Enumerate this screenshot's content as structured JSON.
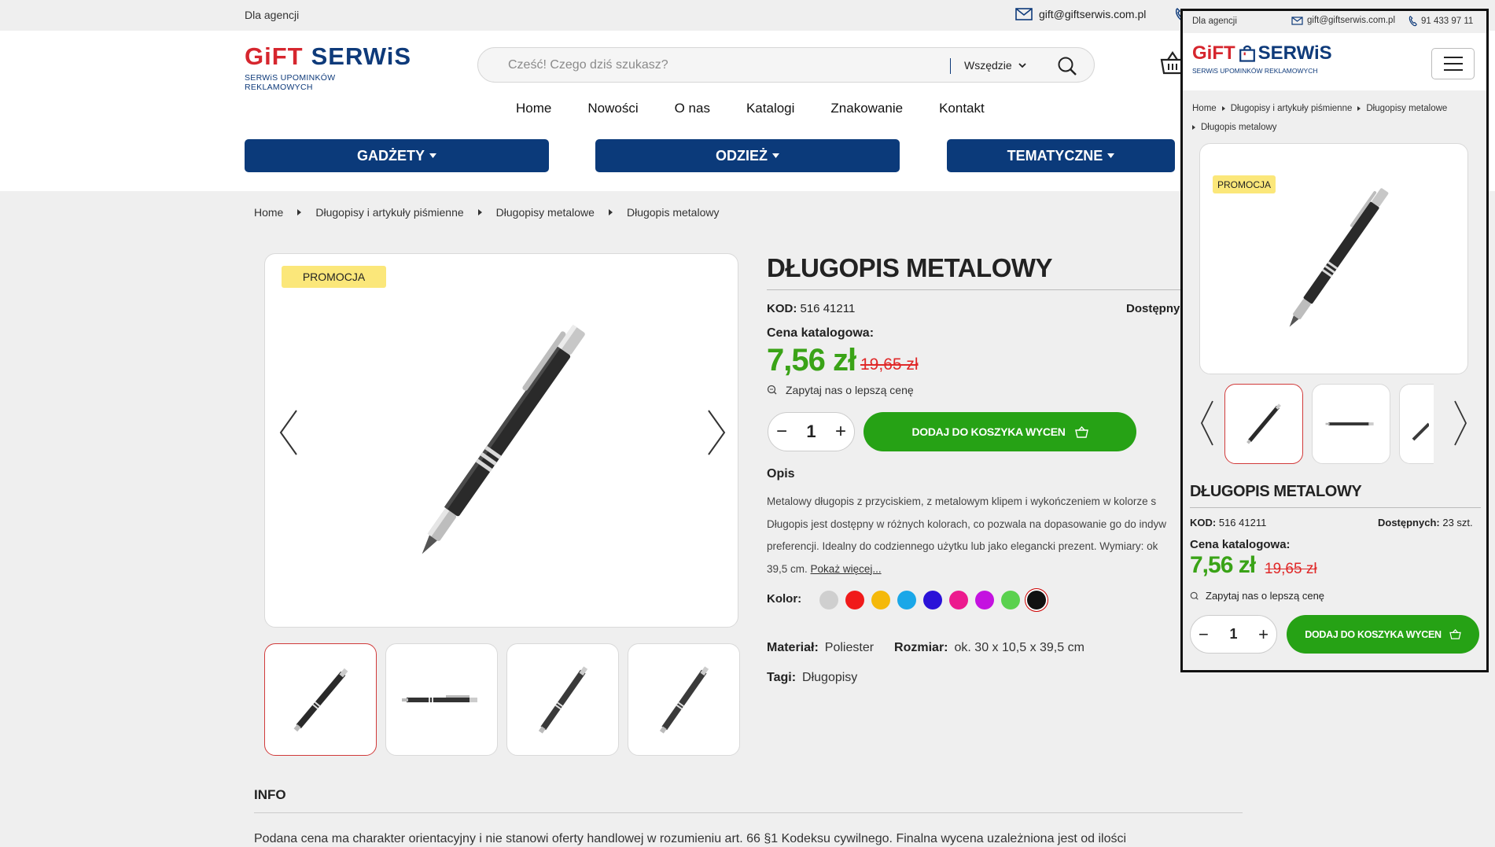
{
  "topbar": {
    "agency": "Dla agencji",
    "email": "gift@giftserwis.com.pl"
  },
  "header": {
    "logo_brand_part1": "GiFT",
    "logo_brand_part2": "SERWiS",
    "logo_tagline": "SERWiS UPOMINKÓW REKLAMOWYCH",
    "search_placeholder": "Cześć!  Czego dziś szukasz?",
    "search_scope": "Wszędzie",
    "nav": [
      "Home",
      "Nowości",
      "O nas",
      "Katalogi",
      "Znakowanie",
      "Kontakt"
    ],
    "categories": [
      "GADŻETY",
      "ODZIEŻ",
      "TEMATYCZNE"
    ]
  },
  "breadcrumb": [
    "Home",
    "Długopisy i artykuły piśmienne",
    "Długopisy metalowe",
    "Długopis metalowy"
  ],
  "product": {
    "promo_badge": "PROMOCJA",
    "title": "DŁUGOPIS METALOWY",
    "code_label": "KOD:",
    "code_value": "516 41211",
    "stock_label": "Dostępny",
    "price_label": "Cena katalogowa:",
    "price": "7,56 zł",
    "old_price": "19,65 zł",
    "ask_better_price": "Zapytaj nas o lepszą cenę",
    "quantity": "1",
    "add_to_cart": "DODAJ DO KOSZYKA WYCEN",
    "description_heading": "Opis",
    "description_lines": [
      "Metalowy długopis z przyciskiem, z metalowym klipem i wykończeniem w kolorze s",
      "Długopis jest dostępny w różnych kolorach, co pozwala na dopasowanie go do indyw",
      "preferencji. Idealny do codziennego użytku lub jako elegancki prezent. Wymiary: ok",
      "39,5 cm."
    ],
    "show_more": "Pokaż więcej...",
    "color_label": "Kolor:",
    "colors": [
      "#cfcfcf",
      "#f01a1a",
      "#f5b90a",
      "#1aa7e8",
      "#2a12d8",
      "#ec1a8e",
      "#c412e0",
      "#5ad14e",
      "#111111"
    ],
    "material_label": "Materiał:",
    "material_value": "Poliester",
    "size_label": "Rozmiar:",
    "size_value": "ok. 30 x 10,5 x 39,5 cm",
    "tags_label": "Tagi:",
    "tags_value": "Długopisy"
  },
  "info": {
    "heading": "INFO",
    "text": "Podana cena ma charakter orientacyjny i nie stanowi oferty handlowej w rozumieniu art. 66 §1 Kodeksu cywilnego. Finalna wycena uzależniona jest od ilości"
  },
  "mobile": {
    "agency": "Dla agencji",
    "email": "gift@giftserwis.com.pl",
    "phone": "91 433 97 11",
    "logo_brand_part1": "GiFT",
    "logo_brand_part2": "SERWiS",
    "logo_tagline": "SERWiS UPOMINKÓW REKLAMOWYCH",
    "breadcrumb": [
      "Home",
      "Długopisy i artykuły piśmienne",
      "Długopisy metalowe",
      "Długopis metalowy"
    ],
    "promo_badge": "PROMOCJA",
    "title": "DŁUGOPIS METALOWY",
    "code_label": "KOD:",
    "code_value": "516 41211",
    "stock_label": "Dostępnych:",
    "stock_value": "23 szt.",
    "price_label": "Cena katalogowa:",
    "price": "7,56 zł",
    "old_price": "19,65 zł",
    "ask_better_price": "Zapytaj nas o lepszą cenę",
    "quantity": "1",
    "add_to_cart": "DODAJ DO KOSZYKA WYCEN"
  }
}
